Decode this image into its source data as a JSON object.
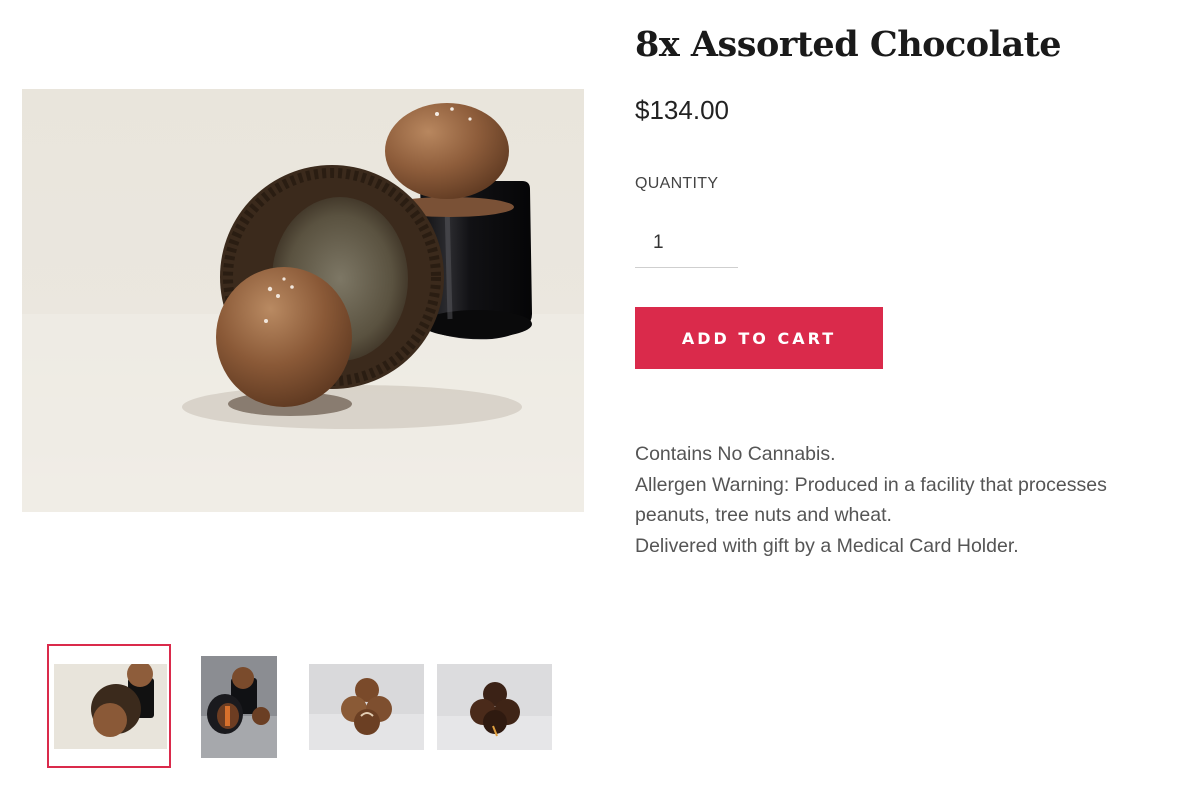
{
  "product": {
    "title": "8x Assorted Chocolate",
    "price": "$134.00",
    "quantity_label": "QUANTITY",
    "quantity_value": "1",
    "add_to_cart_label": "ADD TO CART",
    "description": [
      "Contains No Cannabis.",
      "Allergen Warning: Produced in a facility that processes",
      "peanuts, tree nuts and wheat.",
      "Delivered with gift by a Medical Card Holder."
    ]
  },
  "gallery": {
    "selected_index": 0,
    "thumbnail_count": 4
  },
  "colors": {
    "accent": "#da2a4b",
    "button_text": "#ffffff",
    "description_text": "#555555"
  }
}
